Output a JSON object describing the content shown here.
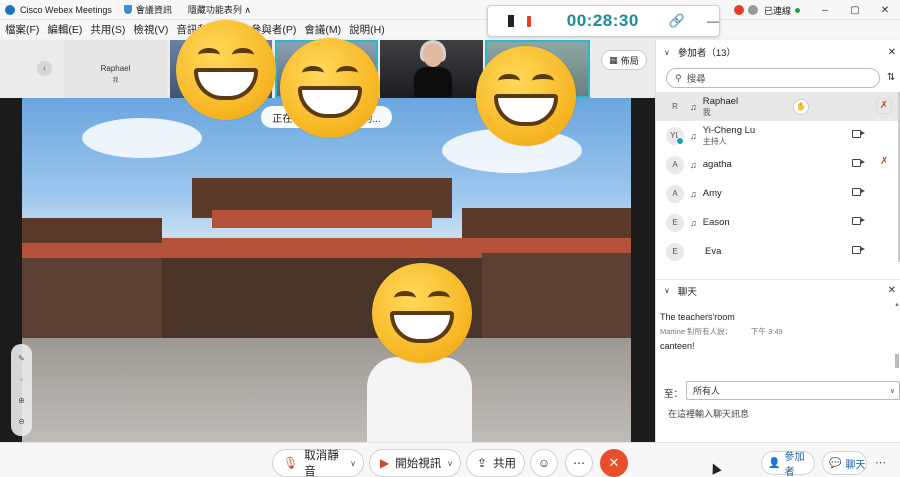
{
  "titlebar": {
    "app_title": "Cisco Webex Meetings",
    "meeting_info": "會議資訊",
    "hidden_menu": "隱藏功能表列 ∧",
    "connected": "已連線",
    "minimize": "–",
    "maximize": "▢",
    "close": "✕"
  },
  "menubar": [
    "檔案(F)",
    "編輯(E)",
    "共用(S)",
    "檢視(V)",
    "音訊和視訊(A)",
    "參與者(P)",
    "會議(M)",
    "說明(H)"
  ],
  "recorder": {
    "time": "00:28:30"
  },
  "strip": {
    "self_name": "Raphael",
    "self_sub": "我",
    "layout_label": "佈局"
  },
  "stage": {
    "speaking_prefix": "正在",
    "speaking_suffix": "的..."
  },
  "participants_panel": {
    "title": "參加者（13）",
    "search_placeholder": "搜尋",
    "list": [
      {
        "initial": "R",
        "name": "Raphael",
        "role": "我"
      },
      {
        "initial": "YL",
        "name": "Yi-Cheng Lu",
        "role": "主持人"
      },
      {
        "initial": "A",
        "name": "agatha",
        "role": ""
      },
      {
        "initial": "A",
        "name": "Amy",
        "role": ""
      },
      {
        "initial": "E",
        "name": "Eason",
        "role": ""
      },
      {
        "initial": "E",
        "name": "Eva",
        "role": ""
      }
    ]
  },
  "chat_panel": {
    "title": "聊天",
    "messages": [
      {
        "text": "The teachers'room"
      },
      {
        "text": "canteen!"
      }
    ],
    "meta_sender": "Martine 對所有人說：",
    "meta_time": "下午 3:49",
    "to_label": "至：",
    "to_value": "所有人",
    "input_placeholder": "在這裡輸入聊天訊息"
  },
  "bottombar": {
    "mute": "取消靜音",
    "video": "開始視訊",
    "share": "共用",
    "participants": "參加者",
    "chat": "聊天"
  },
  "colors": {
    "accent_teal": "#1a8d9c",
    "record_red": "#e1412b",
    "end_red": "#e84d2c"
  }
}
